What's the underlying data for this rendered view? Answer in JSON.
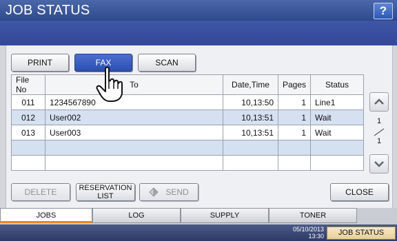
{
  "window": {
    "title": "JOB STATUS",
    "help_label": "?"
  },
  "job_type_tabs": [
    {
      "label": "PRINT",
      "active": false
    },
    {
      "label": "FAX",
      "active": true
    },
    {
      "label": "SCAN",
      "active": false
    }
  ],
  "table": {
    "columns": [
      "File No",
      "To",
      "Date,Time",
      "Pages",
      "Status"
    ],
    "rows": [
      {
        "file_no": "011",
        "to": "1234567890",
        "date_time": "10,13:50",
        "pages": "1",
        "status": "Line1"
      },
      {
        "file_no": "012",
        "to": "User002",
        "date_time": "10,13:51",
        "pages": "1",
        "status": "Wait"
      },
      {
        "file_no": "013",
        "to": "User003",
        "date_time": "10,13:51",
        "pages": "1",
        "status": "Wait"
      }
    ]
  },
  "pager": {
    "current": "1",
    "total": "1"
  },
  "actions": {
    "delete_label": "DELETE",
    "reservation_line1": "RESERVATION",
    "reservation_line2": "LIST",
    "send_label": "SEND",
    "close_label": "CLOSE"
  },
  "bottom_tabs": [
    {
      "label": "JOBS",
      "active": true
    },
    {
      "label": "LOG",
      "active": false
    },
    {
      "label": "SUPPLY",
      "active": false
    },
    {
      "label": "TONER",
      "active": false
    }
  ],
  "status_bar": {
    "date": "05/10/2013",
    "time": "13:30",
    "job_status_label": "JOB STATUS"
  },
  "colors": {
    "title_bar": "#3a56a0",
    "active_tab_underline": "#e7891f",
    "selected_button": "#2b4fb0"
  },
  "icons": {
    "help": "question-mark-icon",
    "cursor": "hand-pointer-icon",
    "send": "diamond-icon",
    "scroll_up": "chevron-up-icon",
    "scroll_down": "chevron-down-icon"
  }
}
